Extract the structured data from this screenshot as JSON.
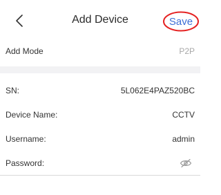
{
  "header": {
    "title": "Add Device",
    "save_label": "Save",
    "back_icon": "chevron-left-icon"
  },
  "form": {
    "add_mode": {
      "label": "Add Mode",
      "value": "P2P"
    },
    "sn": {
      "label": "SN:",
      "value": "5L062E4PAZ520BC"
    },
    "device_name": {
      "label": "Device Name:",
      "value": "CCTV"
    },
    "username": {
      "label": "Username:",
      "value": "admin"
    },
    "password": {
      "label": "Password:",
      "value": "",
      "icon": "eye-hidden-icon"
    }
  },
  "colors": {
    "accent": "#3d6fd6",
    "highlight_ring": "#e52222",
    "muted_text": "#a8a8a8"
  }
}
